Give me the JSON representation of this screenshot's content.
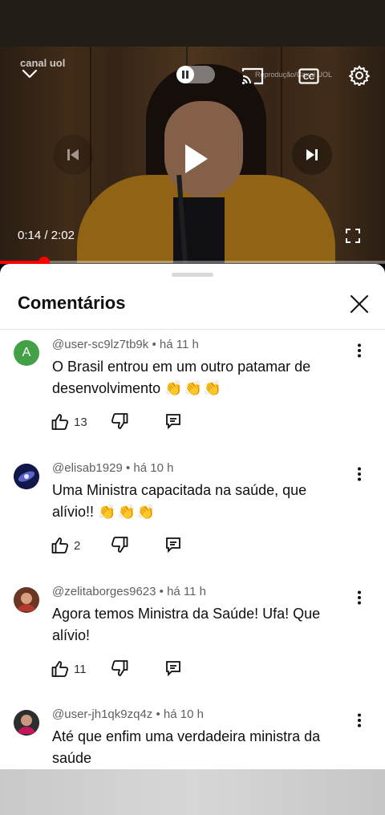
{
  "video": {
    "watermark": "canal uol",
    "overlay_text": "Reprodução/Canal UOL",
    "current_time": "0:14",
    "duration": "2:02",
    "time_separator": " / ",
    "progress_fraction": 0.115,
    "autoplay_on": false,
    "accent_color": "#ff0000"
  },
  "comments_sheet": {
    "title": "Comentários",
    "comments": [
      {
        "user": "@user-sc9lz7tb9k",
        "time": "há 11 h",
        "text": "O Brasil entrou em um outro patamar de desenvolvimento",
        "emoji": "👏👏👏",
        "likes": "13",
        "avatar_letter": "A",
        "avatar_color": "#43a047"
      },
      {
        "user": "@elisab1929",
        "time": "há 10 h",
        "text": "Uma Ministra capacitada na saúde, que alívio!!",
        "emoji": "👏👏👏",
        "likes": "2",
        "avatar_letter": "",
        "avatar_color": "#1a1f5a"
      },
      {
        "user": "@zelitaborges9623",
        "time": "há 11 h",
        "text": "Agora temos Ministra da Saúde! Ufa! Que alívio!",
        "emoji": "",
        "likes": "11",
        "avatar_letter": "",
        "avatar_color": "#7a3b2a"
      },
      {
        "user": "@user-jh1qk9zq4z",
        "time": "há 10 h",
        "text": "Até que enfim uma verdadeira ministra da saúde",
        "emoji": "",
        "likes": "",
        "avatar_letter": "",
        "avatar_color": "#3a3a3a"
      }
    ]
  }
}
